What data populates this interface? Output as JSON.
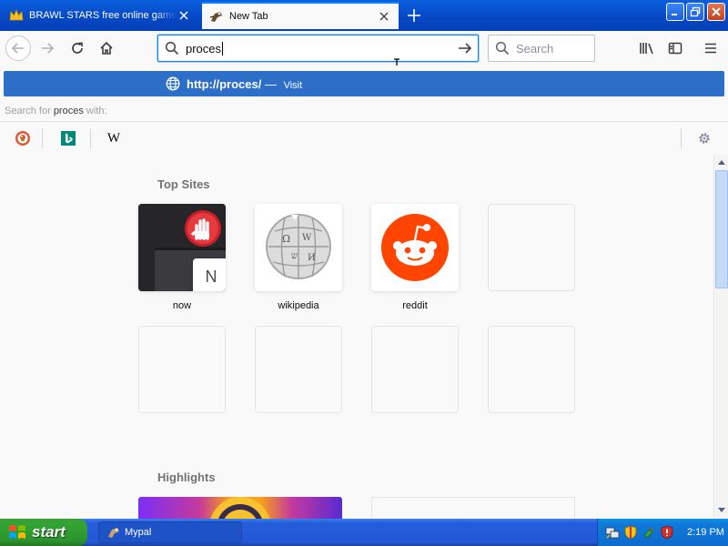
{
  "tabs": [
    {
      "title": "BRAWL STARS free online game o",
      "icon": "crown-icon",
      "active": false
    },
    {
      "title": "New Tab",
      "icon": "mypal-icon",
      "active": true
    }
  ],
  "urlbar": {
    "value": "proces"
  },
  "searchbar": {
    "placeholder": "Search"
  },
  "popup": {
    "suggestion": {
      "url_prefix": "http://",
      "url_match": "proces",
      "url_suffix": "/",
      "separator": " — ",
      "action": "Visit"
    },
    "search_for": {
      "prefix": "Search for",
      "query": "proces",
      "suffix": "with:"
    },
    "engines": [
      "duckduckgo-icon",
      "bing-icon",
      "wikipedia-icon"
    ],
    "wikipedia_glyph": "W"
  },
  "newtab": {
    "top_sites_title": "Top Sites",
    "highlights_title": "Highlights",
    "tiles": [
      {
        "label": "now",
        "badge": "N"
      },
      {
        "label": "wikipedia"
      },
      {
        "label": "reddit"
      }
    ]
  },
  "taskbar": {
    "start_label": "start",
    "task_label": "Mypal",
    "clock": "2:19 PM"
  },
  "colors": {
    "accent": "#0a84ff",
    "suggest_highlight": "#2d6ec8",
    "titlebar": "#0647c3",
    "reddit": "#ff4500"
  }
}
